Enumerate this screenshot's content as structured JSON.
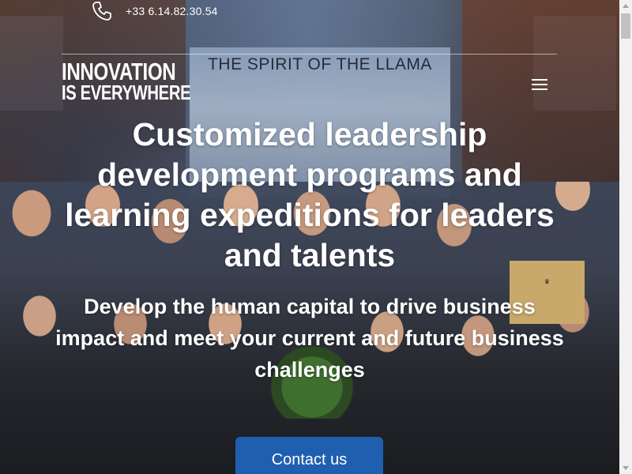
{
  "header": {
    "phone_number": "+33 6.14.82.30.54",
    "phone_icon": "phone-icon",
    "logo": {
      "line1": "INNOVATION",
      "line2": "IS EVERYWHERE"
    },
    "menu_icon": "hamburger-menu-icon"
  },
  "background": {
    "screen_caption": "THE SPIRIT OF THE LLAMA"
  },
  "hero": {
    "headline": "Customized leadership development programs and learning expeditions for leaders and talents",
    "subheadline": "Develop the human capital to drive business impact and meet your current and future business challenges",
    "cta_label": "Contact us"
  },
  "colors": {
    "cta_background": "#1f5fb0",
    "text": "#ffffff"
  }
}
